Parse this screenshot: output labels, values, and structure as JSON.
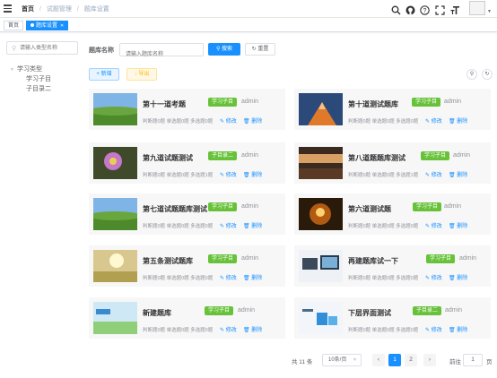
{
  "breadcrumb": [
    "首页",
    "试题管理",
    "题库设置"
  ],
  "tabs": [
    {
      "label": "首页",
      "active": false
    },
    {
      "label": "题库设置",
      "active": true
    }
  ],
  "sidebar": {
    "search_placeholder": "请输入类型名称",
    "tree": [
      {
        "label": "学习类型",
        "level": 0,
        "expanded": true
      },
      {
        "label": "学习子目",
        "level": 1
      },
      {
        "label": "子目录二",
        "level": 1
      }
    ]
  },
  "filter": {
    "label": "题库名称",
    "placeholder": "请输入题库名称",
    "search_label": "搜索",
    "reset_label": "重置"
  },
  "toolbar": {
    "add_label": "新增",
    "export_label": "导出"
  },
  "card_actions": {
    "edit": "修改",
    "delete": "删除"
  },
  "cards": [
    {
      "title": "第十一道考题",
      "category": "学习子目",
      "owner": "admin",
      "stats": "判断题0题 单选题0题 多选题0题",
      "image": "green-hills"
    },
    {
      "title": "第十道测试题库",
      "category": "学习子目",
      "owner": "admin",
      "stats": "判断题0题 单选题0题 多选题0题",
      "image": "sunset-mountain"
    },
    {
      "title": "第九道试题测试",
      "category": "子目录二",
      "owner": "admin",
      "stats": "判断题0题 单选题0题 多选题1题",
      "image": "flower"
    },
    {
      "title": "第八道题题库测试",
      "category": "学习子目",
      "owner": "admin",
      "stats": "判断题0题 单选题0题 多选题1题",
      "image": "desert-sunset"
    },
    {
      "title": "第七道试题题库测试",
      "category": "学习子目",
      "owner": "admin",
      "stats": "判断题0题 单选题0题 多选题0题",
      "image": "green-hills"
    },
    {
      "title": "第六道测试题",
      "category": "学习子目",
      "owner": "admin",
      "stats": "判断题0题 单选题0题 多选题0题",
      "image": "candle-light"
    },
    {
      "title": "第五条测试题库",
      "category": "学习子目",
      "owner": "admin",
      "stats": "判断题0题 单选题0题 多选题0题",
      "image": "sunlit-field"
    },
    {
      "title": "再建题库试一下",
      "category": "学习子目",
      "owner": "admin",
      "stats": "判断题0题 单选题0题 多选题0题",
      "image": "monitors"
    },
    {
      "title": "新建题库",
      "category": "学习子目",
      "owner": "admin",
      "stats": "判断题0题 单选题0题 多选题0题",
      "image": "study-banner"
    },
    {
      "title": "下层界面测试",
      "category": "子目录二",
      "owner": "admin",
      "stats": "判断题0题 单选题0题 多选题0题",
      "image": "blue-boxes"
    }
  ],
  "pagination": {
    "total": "共 11 条",
    "page_size": "10条/页",
    "pages": [
      "1",
      "2"
    ],
    "current": "1",
    "goto_label": "前往",
    "goto_value": "1",
    "page_word": "页",
    "prev": "‹",
    "next": "›"
  },
  "icons": {
    "menu": "hamburger-icon",
    "search": "search-icon",
    "github": "github-icon",
    "help": "question-icon",
    "fullscreen": "fullscreen-icon",
    "font-size": "text-size-icon"
  },
  "colors": {
    "primary": "#1890ff",
    "success": "#67c23a",
    "warning": "#ffba00"
  }
}
